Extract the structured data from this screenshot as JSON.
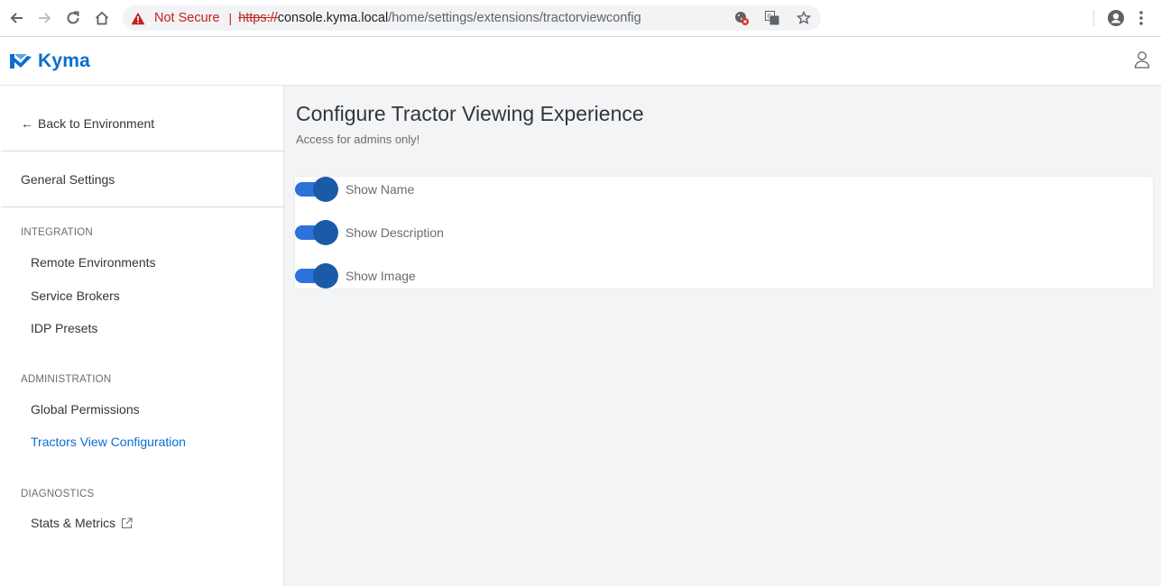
{
  "browser": {
    "security_label": "Not Secure",
    "separator": "|",
    "url_scheme": "https://",
    "url_host": "console.kyma.local",
    "url_path": "/home/settings/extensions/tractorviewconfig"
  },
  "header": {
    "brand": "Kyma",
    "brand_color": "#0a6ed1"
  },
  "sidebar": {
    "back_label": "Back to Environment",
    "general_settings": "General Settings",
    "sections": [
      {
        "title": "INTEGRATION",
        "items": [
          {
            "label": "Remote Environments"
          },
          {
            "label": "Service Brokers"
          },
          {
            "label": "IDP Presets"
          }
        ]
      },
      {
        "title": "ADMINISTRATION",
        "items": [
          {
            "label": "Global Permissions"
          },
          {
            "label": "Tractors View Configuration",
            "active": true
          }
        ]
      },
      {
        "title": "DIAGNOSTICS",
        "items": [
          {
            "label": "Stats & Metrics",
            "icon": "external-link-icon"
          }
        ]
      }
    ]
  },
  "main": {
    "title": "Configure Tractor Viewing Experience",
    "subtitle": "Access for admins only!",
    "toggles": [
      {
        "label": "Show Name",
        "on": true
      },
      {
        "label": "Show Description",
        "on": true
      },
      {
        "label": "Show Image",
        "on": true
      }
    ]
  }
}
